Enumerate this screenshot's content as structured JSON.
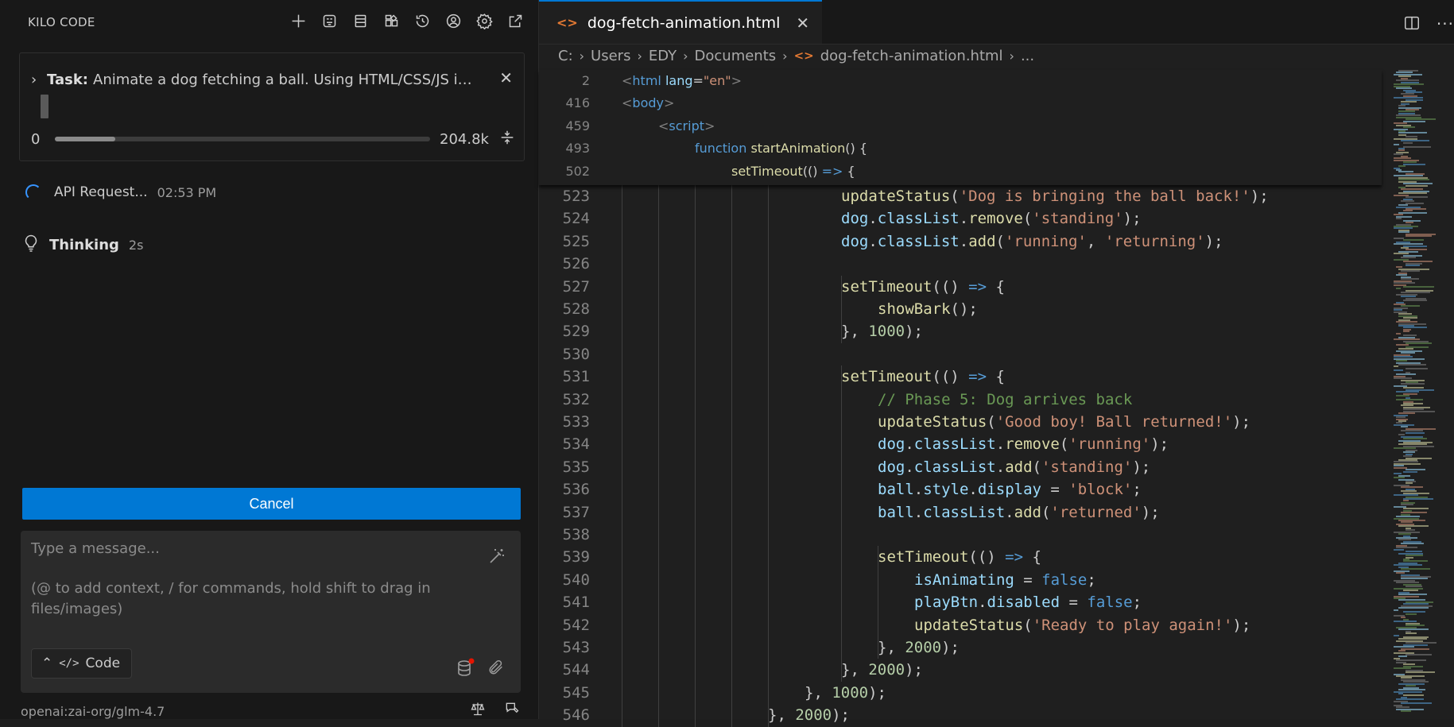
{
  "sidebar": {
    "brand": "KILO CODE",
    "toolbar_icons": [
      "plus-icon",
      "mcp-servers-icon",
      "modes-icon",
      "marketplace-icon",
      "history-icon",
      "account-icon",
      "gear-icon",
      "open-in-editor-icon"
    ],
    "task": {
      "label": "Task:",
      "text": "Animate a dog fetching a ball. Using HTML/CSS/JS in ..."
    },
    "context": {
      "used_label": "0",
      "max_label": "204.8k",
      "used_fraction": 0.16
    },
    "api_request": {
      "label": "API Request...",
      "time": "02:53 PM"
    },
    "thinking": {
      "label": "Thinking",
      "duration": "2s"
    },
    "cancel_label": "Cancel",
    "composer": {
      "placeholder_line1": "Type a message...",
      "placeholder_line2": "(@ to add context, / for commands, hold shift to drag in files/images)",
      "mode_label": "Code"
    },
    "model_label": "openai:zai-org/glm-4.7"
  },
  "editor": {
    "tab_title": "dog-fetch-animation.html",
    "breadcrumbs": [
      "C:",
      "Users",
      "EDY",
      "Documents",
      "dog-fetch-animation.html",
      "..."
    ],
    "sticky_lines": [
      {
        "num": "2",
        "indent": 0,
        "html": "<span class=\"punc\">&lt;</span><span class=\"tag\">html</span> <span class=\"attr\">lang</span>=<span class=\"str\">\"en\"</span><span class=\"punc\">&gt;</span>"
      },
      {
        "num": "416",
        "indent": 0,
        "html": "<span class=\"punc\">&lt;</span><span class=\"tag\">body</span><span class=\"punc\">&gt;</span>"
      },
      {
        "num": "459",
        "indent": 1,
        "html": "<span class=\"punc\">&lt;</span><span class=\"tag\">script</span><span class=\"punc\">&gt;</span>"
      },
      {
        "num": "493",
        "indent": 2,
        "html": "<span class=\"kw\">function</span> <span class=\"fn\">startAnimation</span>() {"
      },
      {
        "num": "502",
        "indent": 3,
        "html": "<span class=\"fn\">setTimeout</span>(() <span class=\"kw\">=&gt;</span> {"
      }
    ],
    "lines": [
      {
        "num": "523",
        "indent": 6,
        "html": "<span class=\"fn\">updateStatus</span>(<span class=\"str\">'Dog is bringing the ball back!'</span>);"
      },
      {
        "num": "524",
        "indent": 6,
        "html": "<span class=\"var\">dog</span>.<span class=\"prop\">classList</span>.<span class=\"fn\">remove</span>(<span class=\"str\">'standing'</span>);"
      },
      {
        "num": "525",
        "indent": 6,
        "html": "<span class=\"var\">dog</span>.<span class=\"prop\">classList</span>.<span class=\"fn\">add</span>(<span class=\"str\">'running'</span>, <span class=\"str\">'returning'</span>);"
      },
      {
        "num": "526",
        "indent": 6,
        "html": ""
      },
      {
        "num": "527",
        "indent": 6,
        "html": "<span class=\"fn\">setTimeout</span>(() <span class=\"kw\">=&gt;</span> {"
      },
      {
        "num": "528",
        "indent": 7,
        "html": "<span class=\"fn\">showBark</span>();"
      },
      {
        "num": "529",
        "indent": 6,
        "html": "}, <span class=\"num-l\">1000</span>);"
      },
      {
        "num": "530",
        "indent": 6,
        "html": ""
      },
      {
        "num": "531",
        "indent": 6,
        "html": "<span class=\"fn\">setTimeout</span>(() <span class=\"kw\">=&gt;</span> {"
      },
      {
        "num": "532",
        "indent": 7,
        "html": "<span class=\"cmt\">// Phase 5: Dog arrives back</span>"
      },
      {
        "num": "533",
        "indent": 7,
        "html": "<span class=\"fn\">updateStatus</span>(<span class=\"str\">'Good boy! Ball returned!'</span>);"
      },
      {
        "num": "534",
        "indent": 7,
        "html": "<span class=\"var\">dog</span>.<span class=\"prop\">classList</span>.<span class=\"fn\">remove</span>(<span class=\"str\">'running'</span>);"
      },
      {
        "num": "535",
        "indent": 7,
        "html": "<span class=\"var\">dog</span>.<span class=\"prop\">classList</span>.<span class=\"fn\">add</span>(<span class=\"str\">'standing'</span>);"
      },
      {
        "num": "536",
        "indent": 7,
        "html": "<span class=\"var\">ball</span>.<span class=\"prop\">style</span>.<span class=\"prop\">display</span> = <span class=\"str\">'block'</span>;"
      },
      {
        "num": "537",
        "indent": 7,
        "html": "<span class=\"var\">ball</span>.<span class=\"prop\">classList</span>.<span class=\"fn\">add</span>(<span class=\"str\">'returned'</span>);"
      },
      {
        "num": "538",
        "indent": 7,
        "html": ""
      },
      {
        "num": "539",
        "indent": 7,
        "html": "<span class=\"fn\">setTimeout</span>(() <span class=\"kw\">=&gt;</span> {"
      },
      {
        "num": "540",
        "indent": 8,
        "html": "<span class=\"var\">isAnimating</span> = <span class=\"kw\">false</span>;"
      },
      {
        "num": "541",
        "indent": 8,
        "html": "<span class=\"var\">playBtn</span>.<span class=\"prop\">disabled</span> = <span class=\"kw\">false</span>;"
      },
      {
        "num": "542",
        "indent": 8,
        "html": "<span class=\"fn\">updateStatus</span>(<span class=\"str\">'Ready to play again!'</span>);"
      },
      {
        "num": "543",
        "indent": 7,
        "html": "}, <span class=\"num-l\">2000</span>);"
      },
      {
        "num": "544",
        "indent": 6,
        "html": "}, <span class=\"num-l\">2000</span>);"
      },
      {
        "num": "545",
        "indent": 5,
        "html": "}, <span class=\"num-l\">1000</span>);"
      },
      {
        "num": "546",
        "indent": 4,
        "html": "}, <span class=\"num-l\">2000</span>);"
      }
    ]
  }
}
